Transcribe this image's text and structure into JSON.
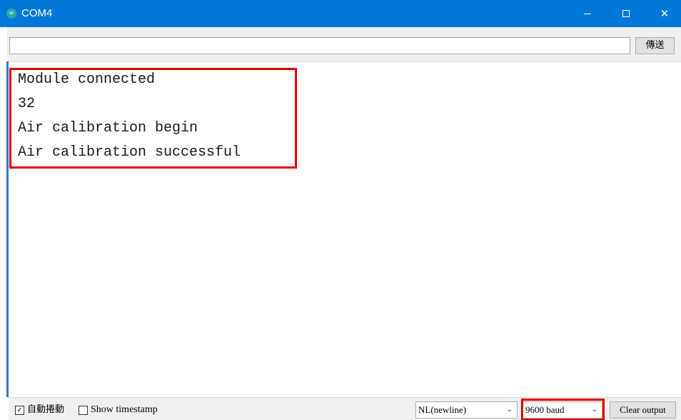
{
  "window": {
    "title": "COM4",
    "icon": "arduino-infinity-icon",
    "controls": {
      "minimize_icon": "minimize-icon",
      "maximize_icon": "maximize-icon",
      "close_label": "✕"
    }
  },
  "send": {
    "input_value": "",
    "button_label": "傳送"
  },
  "output": {
    "lines": [
      "Module connected",
      "32",
      "Air calibration begin",
      "Air calibration successful"
    ],
    "highlight_color": "#e00000"
  },
  "footer": {
    "autoscroll": {
      "label": "自動捲動",
      "checked": true,
      "mark": "✓"
    },
    "timestamp": {
      "label": "Show timestamp",
      "checked": false
    },
    "line_ending": {
      "selected": "NL(newline)",
      "arrow": "⌄"
    },
    "baud_rate": {
      "selected": "9600 baud",
      "arrow": "⌄"
    },
    "clear_label": "Clear output"
  },
  "colors": {
    "titlebar": "#0078d7",
    "accent": "#3f6fbf",
    "highlight": "#e00000"
  }
}
